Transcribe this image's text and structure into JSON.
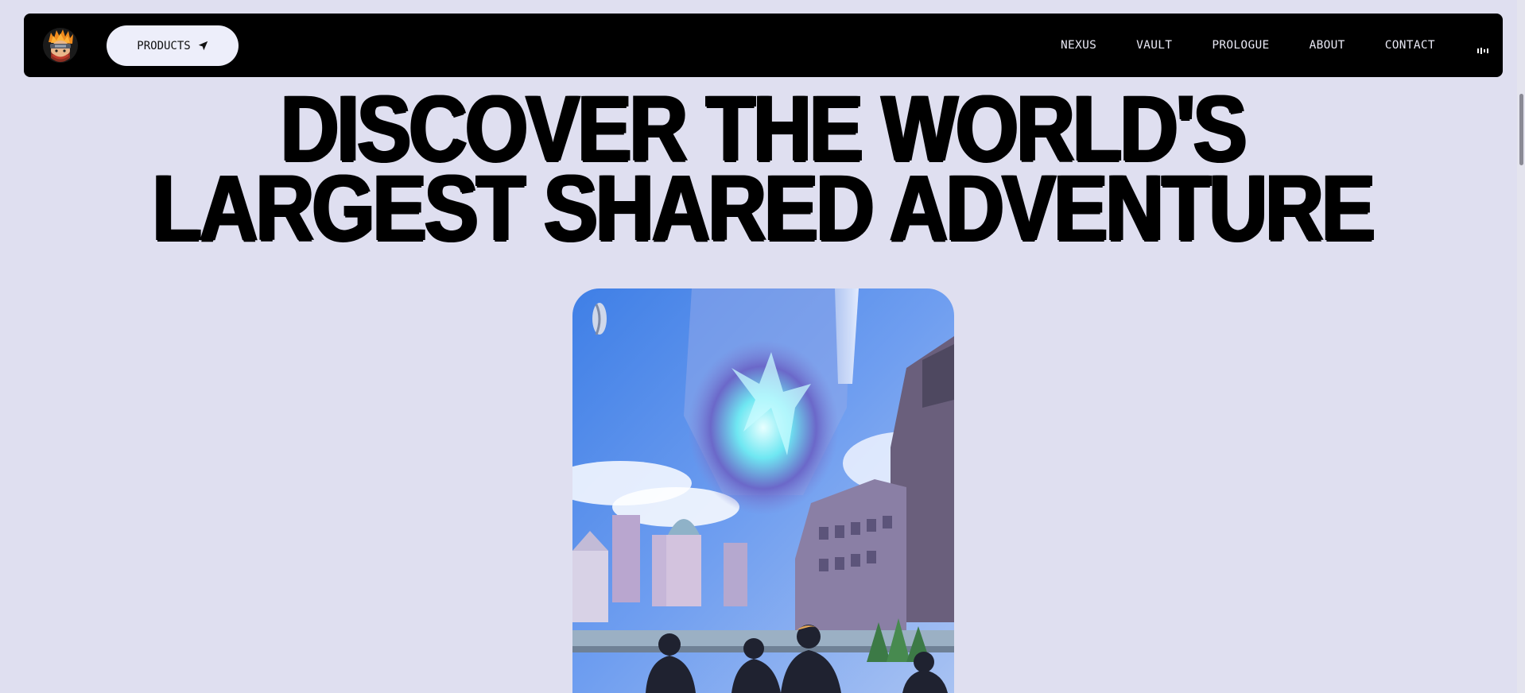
{
  "navbar": {
    "logo_icon": "ninja-avatar-logo",
    "products_label": "PRODUCTS",
    "products_icon": "paper-plane-icon",
    "links": [
      "NEXUS",
      "VAULT",
      "PROLOGUE",
      "ABOUT",
      "CONTACT"
    ],
    "audio_icon": "audio-bars-icon"
  },
  "hero": {
    "title_line1": "DISCOVER THE WORLD'S",
    "title_line2": "LARGEST SHARED ADVENTURE",
    "image_icon": "fantasy-city-illustration"
  },
  "colors": {
    "background": "#dfdff0",
    "navbar": "#000000",
    "button": "#edeefa",
    "text_dark": "#000000",
    "text_light": "#e8e8f4"
  }
}
